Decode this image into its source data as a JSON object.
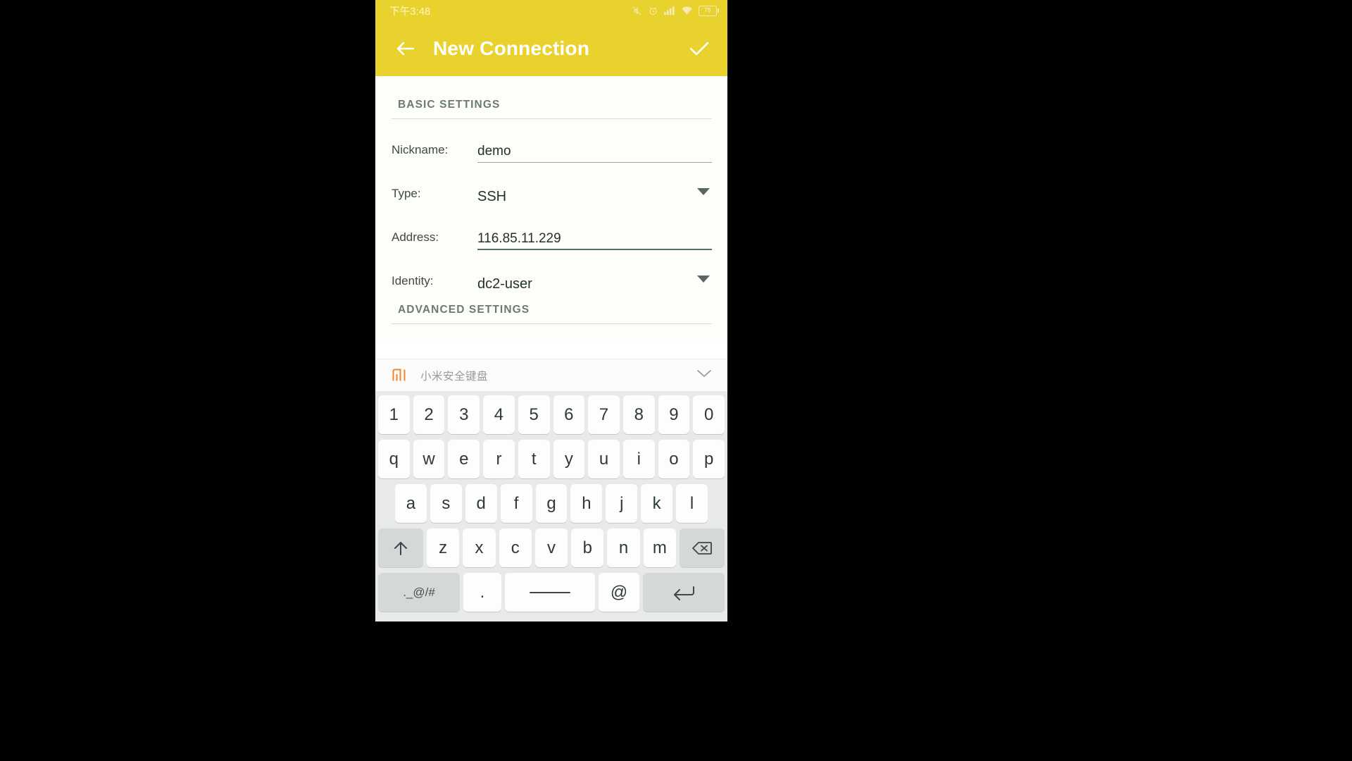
{
  "statusbar": {
    "time": "下午3:48",
    "icons": [
      "mute-icon",
      "alarm-icon",
      "signal-icon",
      "wifi-icon",
      "battery-icon"
    ],
    "battery_level": "75"
  },
  "appbar": {
    "back_icon": "arrow-left-icon",
    "title": "New Connection",
    "confirm_icon": "check-icon",
    "background_color": "#e9d22e"
  },
  "form": {
    "basic_section_title": "BASIC SETTINGS",
    "advanced_section_title": "ADVANCED SETTINGS",
    "fields": [
      {
        "label": "Nickname:",
        "value": "demo",
        "kind": "text",
        "focused": false
      },
      {
        "label": "Type:",
        "value": "SSH",
        "kind": "select",
        "focused": false
      },
      {
        "label": "Address:",
        "value": "116.85.11.229",
        "kind": "text",
        "focused": true
      },
      {
        "label": "Identity:",
        "value": "dc2-user",
        "kind": "select",
        "focused": false
      }
    ]
  },
  "keyboard": {
    "brand_logo": "mi-logo-icon",
    "name": "小米安全键盘",
    "collapse_icon": "chevron-down-icon",
    "row_numbers": [
      "1",
      "2",
      "3",
      "4",
      "5",
      "6",
      "7",
      "8",
      "9",
      "0"
    ],
    "row_q": [
      "q",
      "w",
      "e",
      "r",
      "t",
      "y",
      "u",
      "i",
      "o",
      "p"
    ],
    "row_a": [
      "a",
      "s",
      "d",
      "f",
      "g",
      "h",
      "j",
      "k",
      "l"
    ],
    "row_z": [
      "z",
      "x",
      "c",
      "v",
      "b",
      "n",
      "m"
    ],
    "shift_icon": "shift-up-icon",
    "backspace_icon": "backspace-icon",
    "symbols_label": "._@/#",
    "period_label": ".",
    "space_label": "",
    "at_label": "@",
    "enter_icon": "enter-return-icon",
    "key_color": "#fdfdfd",
    "fn_key_color": "#d4d8d8",
    "background_color": "#e8eaea"
  }
}
